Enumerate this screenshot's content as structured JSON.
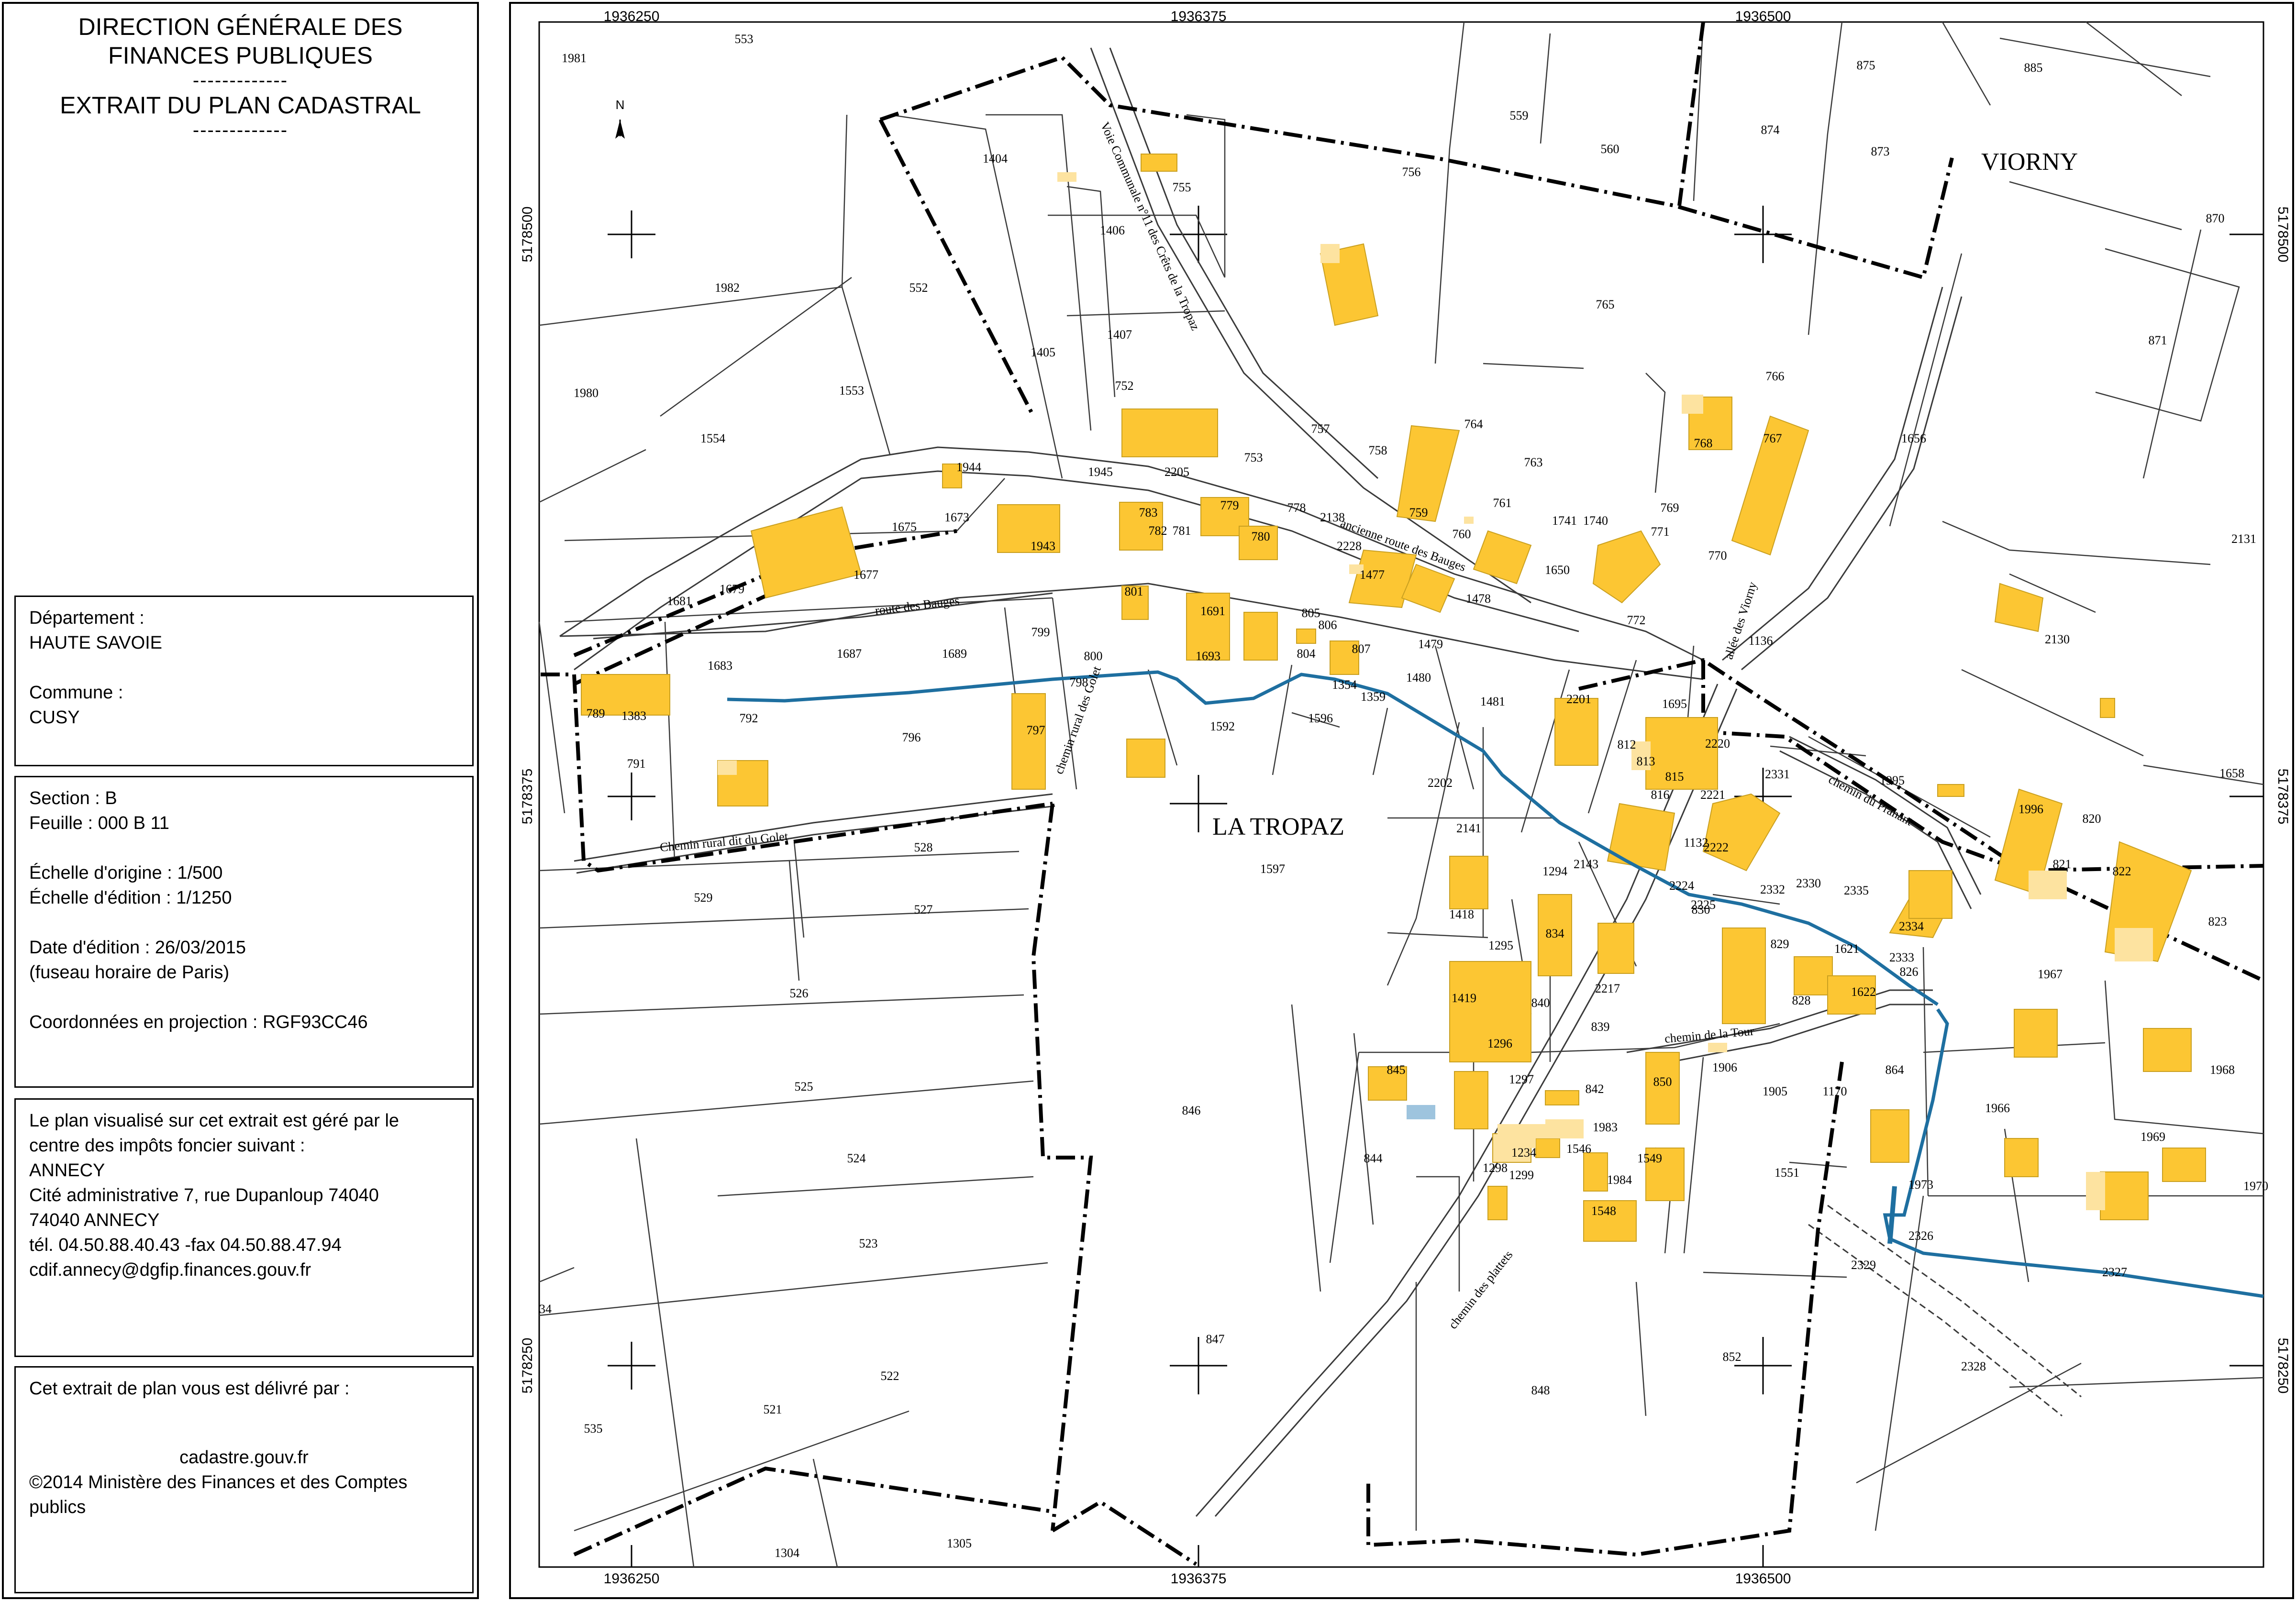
{
  "header": {
    "line1": "DIRECTION GÉNÉRALE DES",
    "line2": "FINANCES PUBLIQUES",
    "sep1": "-------------",
    "line3": "EXTRAIT DU PLAN CADASTRAL",
    "sep2": "-------------"
  },
  "location": {
    "dept_label": "Département :",
    "dept_value": "HAUTE SAVOIE",
    "commune_label": "Commune :",
    "commune_value": "CUSY"
  },
  "sheet": {
    "section": "Section : B",
    "feuille": "Feuille : 000 B 11",
    "echelle_origine": "Échelle d'origine : 1/500",
    "echelle_edition": "Échelle d'édition : 1/1250",
    "date_edition": "Date d'édition : 26/03/2015",
    "fuseau": "(fuseau horaire de Paris)",
    "coordonnees": "Coordonnées en projection : RGF93CC46"
  },
  "office": {
    "line1": "Le plan visualisé sur cet extrait est géré par le",
    "line2": "centre des impôts foncier suivant :",
    "line3": "ANNECY",
    "line4": "Cité administrative 7, rue Dupanloup 74040",
    "line5": "74040 ANNECY",
    "line6": "tél. 04.50.88.40.43 -fax 04.50.88.47.94",
    "line7": "cdif.annecy@dgfip.finances.gouv.fr"
  },
  "delivery": {
    "line1": "Cet extrait de plan vous est délivré par :",
    "line2": "cadastre.gouv.fr",
    "line3": "©2014 Ministère des Finances et des Comptes",
    "line4": "publics"
  },
  "map": {
    "coords_x": [
      "1936250",
      "1936375",
      "1936500"
    ],
    "coords_y": [
      "5178500",
      "5178375",
      "5178250"
    ],
    "place_names": [
      "VIORNY",
      "LA TROPAZ"
    ],
    "north": "N",
    "streets": [
      "route des Bauges",
      "ancienne route des Bauges",
      "Chemin rural dit du Golet",
      "chemin du Pranant",
      "chemin de la Tour",
      "chemin des plattets",
      "allée des Viorny",
      "Voie Communale n°11 des Crêts de la Tropaz",
      "chemin rural des Golet"
    ],
    "colors": {
      "building": "#fcc633",
      "building_light": "#fde3a0",
      "water": "#1e6fa0",
      "line": "#000000"
    },
    "parcels": [
      {
        "id": "1981"
      },
      {
        "id": "553"
      },
      {
        "id": "1404"
      },
      {
        "id": "755"
      },
      {
        "id": "756"
      },
      {
        "id": "559"
      },
      {
        "id": "560"
      },
      {
        "id": "874"
      },
      {
        "id": "875"
      },
      {
        "id": "873"
      },
      {
        "id": "885"
      },
      {
        "id": "870"
      },
      {
        "id": "1982"
      },
      {
        "id": "552"
      },
      {
        "id": "1406"
      },
      {
        "id": "765"
      },
      {
        "id": "871"
      },
      {
        "id": "1980"
      },
      {
        "id": "1553"
      },
      {
        "id": "1405"
      },
      {
        "id": "1407"
      },
      {
        "id": "766"
      },
      {
        "id": "1554"
      },
      {
        "id": "752"
      },
      {
        "id": "757"
      },
      {
        "id": "758"
      },
      {
        "id": "764"
      },
      {
        "id": "763"
      },
      {
        "id": "768"
      },
      {
        "id": "767"
      },
      {
        "id": "1656"
      },
      {
        "id": "1944"
      },
      {
        "id": "1945"
      },
      {
        "id": "2205"
      },
      {
        "id": "753"
      },
      {
        "id": "759"
      },
      {
        "id": "761"
      },
      {
        "id": "769"
      },
      {
        "id": "1675"
      },
      {
        "id": "1673"
      },
      {
        "id": "783"
      },
      {
        "id": "779"
      },
      {
        "id": "778"
      },
      {
        "id": "2138"
      },
      {
        "id": "760"
      },
      {
        "id": "1741"
      },
      {
        "id": "1740"
      },
      {
        "id": "771"
      },
      {
        "id": "770"
      },
      {
        "id": "1677"
      },
      {
        "id": "1943"
      },
      {
        "id": "782"
      },
      {
        "id": "781"
      },
      {
        "id": "780"
      },
      {
        "id": "2228"
      },
      {
        "id": "1650"
      },
      {
        "id": "2131"
      },
      {
        "id": "1681"
      },
      {
        "id": "1679"
      },
      {
        "id": "1477"
      },
      {
        "id": "1478"
      },
      {
        "id": "772"
      },
      {
        "id": "2130"
      },
      {
        "id": "801"
      },
      {
        "id": "1691"
      },
      {
        "id": "805"
      },
      {
        "id": "806"
      },
      {
        "id": "799"
      },
      {
        "id": "1683"
      },
      {
        "id": "1687"
      },
      {
        "id": "1689"
      },
      {
        "id": "800"
      },
      {
        "id": "1693"
      },
      {
        "id": "804"
      },
      {
        "id": "807"
      },
      {
        "id": "1479"
      },
      {
        "id": "1136"
      },
      {
        "id": "798"
      },
      {
        "id": "1354"
      },
      {
        "id": "1480"
      },
      {
        "id": "1481"
      },
      {
        "id": "2201"
      },
      {
        "id": "789"
      },
      {
        "id": "1383"
      },
      {
        "id": "792"
      },
      {
        "id": "1359"
      },
      {
        "id": "1695"
      },
      {
        "id": "796"
      },
      {
        "id": "797"
      },
      {
        "id": "1592"
      },
      {
        "id": "1596"
      },
      {
        "id": "812"
      },
      {
        "id": "2220"
      },
      {
        "id": "1995"
      },
      {
        "id": "1658"
      },
      {
        "id": "791"
      },
      {
        "id": "813"
      },
      {
        "id": "815"
      },
      {
        "id": "2202"
      },
      {
        "id": "816"
      },
      {
        "id": "2221"
      },
      {
        "id": "2331"
      },
      {
        "id": "1996"
      },
      {
        "id": "820"
      },
      {
        "id": "2141"
      },
      {
        "id": "1132"
      },
      {
        "id": "2222"
      },
      {
        "id": "821"
      },
      {
        "id": "822"
      },
      {
        "id": "528"
      },
      {
        "id": "1597"
      },
      {
        "id": "1294"
      },
      {
        "id": "2143"
      },
      {
        "id": "2332"
      },
      {
        "id": "2330"
      },
      {
        "id": "2335"
      },
      {
        "id": "529"
      },
      {
        "id": "1418"
      },
      {
        "id": "2224"
      },
      {
        "id": "2225"
      },
      {
        "id": "830"
      },
      {
        "id": "2334"
      },
      {
        "id": "823"
      },
      {
        "id": "527"
      },
      {
        "id": "834"
      },
      {
        "id": "829"
      },
      {
        "id": "1621"
      },
      {
        "id": "2333"
      },
      {
        "id": "826"
      },
      {
        "id": "1295"
      },
      {
        "id": "1967"
      },
      {
        "id": "526"
      },
      {
        "id": "1419"
      },
      {
        "id": "840"
      },
      {
        "id": "2217"
      },
      {
        "id": "828"
      },
      {
        "id": "1622"
      },
      {
        "id": "839"
      },
      {
        "id": "1296"
      },
      {
        "id": "525"
      },
      {
        "id": "846"
      },
      {
        "id": "845"
      },
      {
        "id": "1297"
      },
      {
        "id": "842"
      },
      {
        "id": "850"
      },
      {
        "id": "1906"
      },
      {
        "id": "1905"
      },
      {
        "id": "1170"
      },
      {
        "id": "864"
      },
      {
        "id": "1968"
      },
      {
        "id": "1966"
      },
      {
        "id": "844"
      },
      {
        "id": "1234"
      },
      {
        "id": "1983"
      },
      {
        "id": "1969"
      },
      {
        "id": "524"
      },
      {
        "id": "1298"
      },
      {
        "id": "1546"
      },
      {
        "id": "1984"
      },
      {
        "id": "1549"
      },
      {
        "id": "1551"
      },
      {
        "id": "1299"
      },
      {
        "id": "1973"
      },
      {
        "id": "1970"
      },
      {
        "id": "1548"
      },
      {
        "id": "523"
      },
      {
        "id": "2326"
      },
      {
        "id": "2329"
      },
      {
        "id": "2327"
      },
      {
        "id": "847"
      },
      {
        "id": "852"
      },
      {
        "id": "2328"
      },
      {
        "id": "522"
      },
      {
        "id": "34"
      },
      {
        "id": "848"
      },
      {
        "id": "521"
      },
      {
        "id": "535"
      },
      {
        "id": "1304"
      },
      {
        "id": "1305"
      }
    ]
  }
}
